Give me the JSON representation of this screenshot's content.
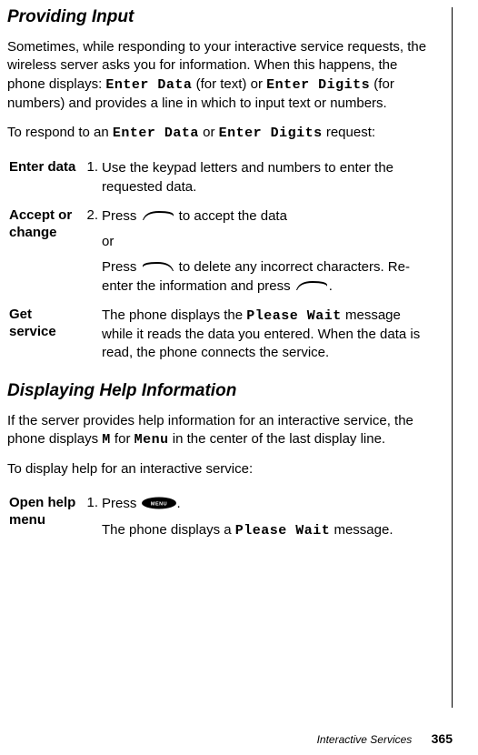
{
  "heading1": "Providing Input",
  "intro1_pre": "Sometimes, while responding to your interactive service requests, the wireless server asks you for information. When this happens, the phone displays: ",
  "intro1_lcd1": "Enter Data",
  "intro1_mid1": " (for text) or ",
  "intro1_lcd2": "Enter Digits",
  "intro1_post": " (for numbers) and provides a line in which to input text or numbers.",
  "respond_pre": "To respond to an ",
  "respond_lcd1": "Enter Data",
  "respond_mid": " or ",
  "respond_lcd2": "Enter Digits",
  "respond_post": " request:",
  "steps1": {
    "enter_label": "Enter data",
    "enter_num": "1.",
    "enter_text": "Use the keypad letters and numbers to enter the requested data.",
    "accept_label": "Accept or change",
    "accept_num": "2.",
    "accept_text1_pre": "Press ",
    "accept_text1_post": " to accept the data",
    "accept_or": "or",
    "accept_text2_pre": "Press ",
    "accept_text2_mid": " to delete any incorrect characters. Re-enter the information and press ",
    "accept_text2_post": ".",
    "get_label": "Get service",
    "get_text_pre": "The phone displays the ",
    "get_lcd": "Please Wait",
    "get_text_post": " message while it reads the data you entered. When the data is read, the phone connects the service."
  },
  "heading2": "Displaying Help Information",
  "help_intro_pre": "If the server provides help information for an interactive service, the phone displays ",
  "help_lcd_m": "M",
  "help_intro_mid": " for ",
  "help_lcd_menu": "Menu",
  "help_intro_post": " in the center of the last display line.",
  "help_todisplay": "To display help for an interactive service:",
  "steps2": {
    "open_label": "Open help menu",
    "open_num": "1.",
    "open_text1_pre": "Press ",
    "open_text1_post": ".",
    "open_text2_pre": "The phone displays a ",
    "open_lcd": "Please Wait",
    "open_text2_post": " message."
  },
  "footer_section": "Interactive Services",
  "footer_page": "365",
  "menu_label": "MENU"
}
